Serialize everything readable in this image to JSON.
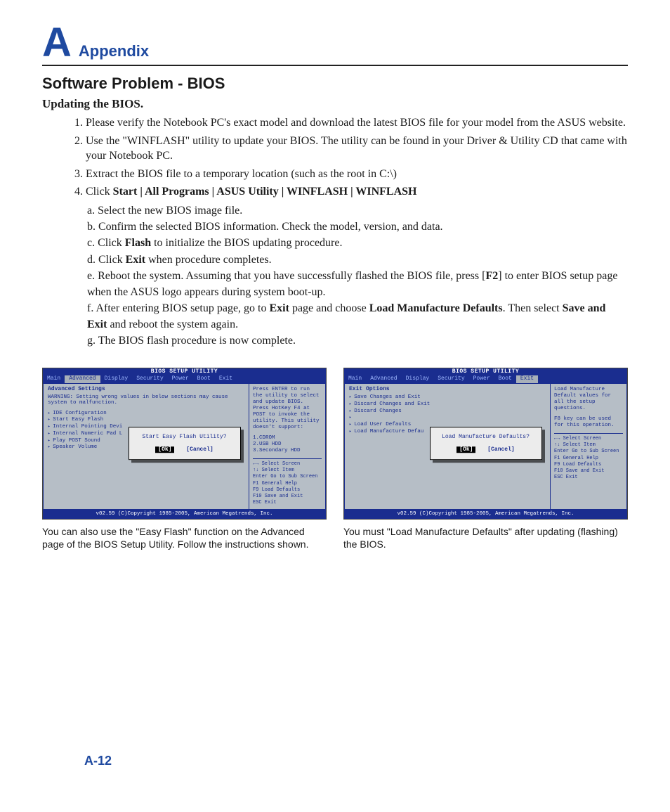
{
  "header": {
    "letter": "A",
    "appendix": "Appendix"
  },
  "h2": "Software Problem - BIOS",
  "h3": "Updating the BIOS.",
  "steps": [
    "Please verify the Notebook PC's exact model and download the latest BIOS file for your model from the ASUS website.",
    "Use the \"WINFLASH\" utility to update your BIOS. The utility can be found in your Driver & Utility CD that came with your Notebook PC.",
    "Extract the BIOS file to a temporary location (such as the root in C:\\)"
  ],
  "step4": {
    "prefix": "Click ",
    "bold": "Start | All Programs | ASUS Utility | WINFLASH | WINFLASH"
  },
  "sub": {
    "a": "a. Select the new BIOS image file.",
    "b": "b. Confirm the selected BIOS information. Check the model, version, and data.",
    "c_pre": "c. Click ",
    "c_bold": "Flash",
    "c_post": " to initialize the BIOS updating procedure.",
    "d_pre": "d. Click ",
    "d_bold": "Exit",
    "d_post": " when procedure completes.",
    "e_pre": "e. Reboot the system. Assuming that you have successfully flashed the BIOS file, press [",
    "e_bold": "F2",
    "e_post": "] to enter BIOS setup page when the ASUS logo appears during system boot-up.",
    "f_pre": "f. After entering BIOS setup page, go to ",
    "f_bold1": "Exit",
    "f_mid": " page and choose ",
    "f_bold2": "Load Manufacture Defaults",
    "f_mid2": ". Then select ",
    "f_bold3": "Save and Exit",
    "f_post": " and reboot the system again.",
    "g": "g. The BIOS flash procedure is now complete."
  },
  "left_caption": "You can also use the \"Easy Flash\" function on the Advanced page of the BIOS Setup Utility. Follow the instructions shown.",
  "right_caption": "You must \"Load Manufacture Defaults\" after updating (flashing) the BIOS.",
  "page_num": "A-12",
  "bios_common": {
    "title": "BIOS SETUP UTILITY",
    "footer": "v02.59 (C)Copyright 1985-2005, American Megatrends, Inc.",
    "ok": "[Ok]",
    "cancel": "[Cancel]"
  },
  "bios_left": {
    "tabs": [
      "Main",
      "Advanced",
      "Display",
      "Security",
      "Power",
      "Boot",
      "Exit"
    ],
    "selected_tab": "Advanced",
    "heading": "Advanced Settings",
    "warning": "WARNING: Setting wrong values in below sections may cause system to malfunction.",
    "menu": [
      "IDE Configuration",
      "Start Easy Flash",
      "Internal Pointing Devi",
      "Internal Numeric Pad L",
      "Play POST Sound",
      "Speaker Volume"
    ],
    "right_help1": "Press ENTER to run the utility to select and update BIOS. Press HotKey F4 at POST to invoke the utility. This utility doesn't support:",
    "right_help2": "1.CDROM\n2.USB HDD\n3.Secondary HDD",
    "keys": [
      "←→  Select Screen",
      "↑↓  Select Item",
      "Enter Go to Sub Screen",
      "F1   General Help",
      "F9   Load Defaults",
      "F10  Save and Exit",
      "ESC  Exit"
    ],
    "dialog": "Start Easy Flash Utility?"
  },
  "bios_right": {
    "tabs": [
      "Main",
      "Advanced",
      "Display",
      "Security",
      "Power",
      "Boot",
      "Exit"
    ],
    "selected_tab": "Exit",
    "heading": "Exit Options",
    "menu": [
      "Save Changes and Exit",
      "Discard Changes and Exit",
      "Discard Changes",
      "",
      "Load User Defaults",
      "Load Manufacture Defau"
    ],
    "right_help1": "Load Manufacture Default values for all the setup questions.",
    "right_help2": "F8 key can be used for this operation.",
    "keys": [
      "←→  Select Screen",
      "↑↓  Select Item",
      "Enter Go to Sub Screen",
      "F1   General Help",
      "F9   Load Defaults",
      "F10  Save and Exit",
      "ESC  Exit"
    ],
    "dialog": "Load Manufacture Defaults?"
  }
}
